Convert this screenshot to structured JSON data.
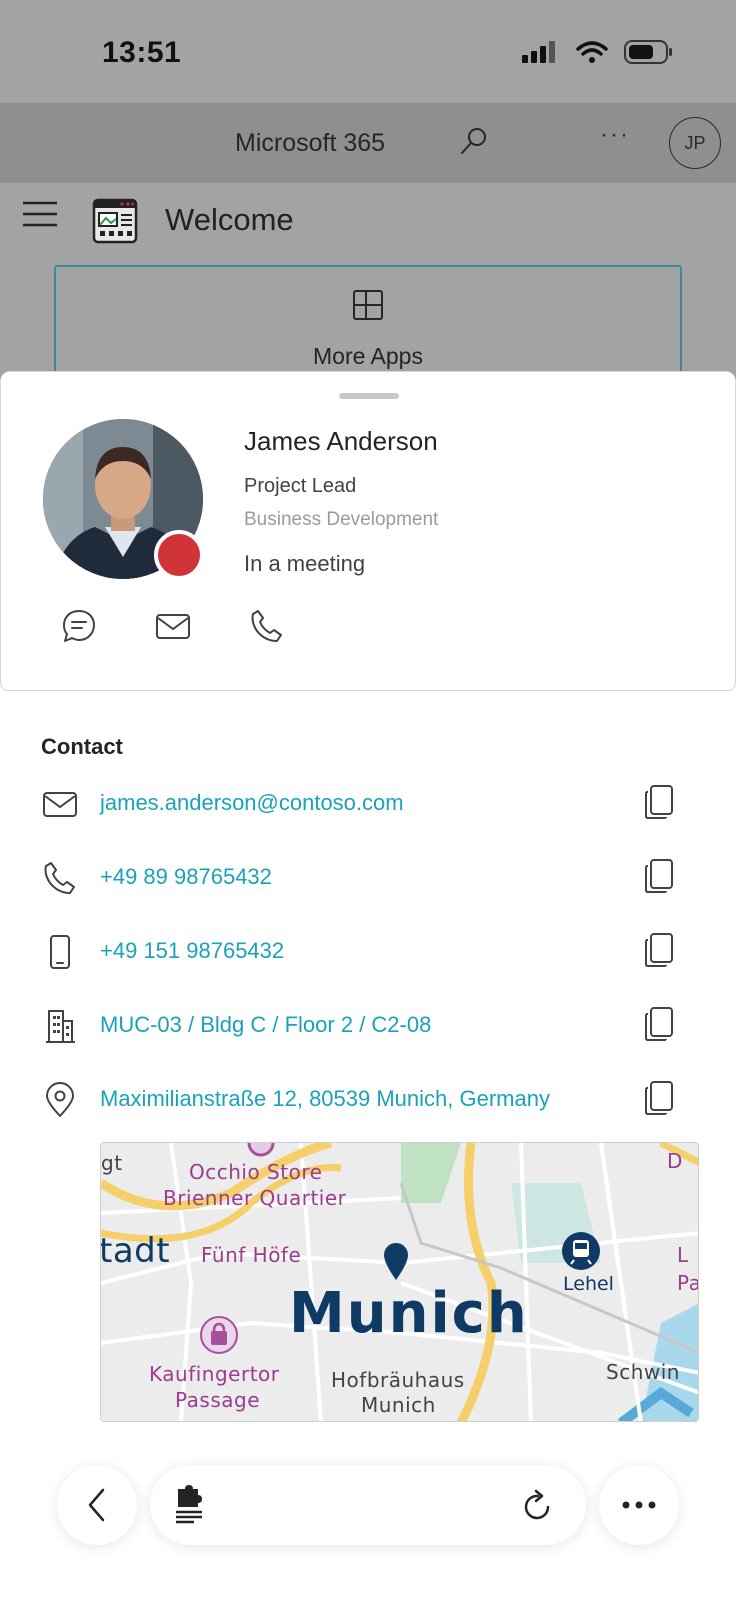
{
  "status_bar": {
    "time": "13:51"
  },
  "app_header": {
    "title": "Microsoft 365",
    "more_label": "···",
    "avatar_initials": "JP"
  },
  "page": {
    "title": "Welcome",
    "more_apps_label": "More Apps"
  },
  "profile": {
    "name": "James Anderson",
    "role": "Project Lead",
    "department": "Business Development",
    "status": "In a meeting",
    "presence_color": "#d13438"
  },
  "contact": {
    "heading": "Contact",
    "email": "james.anderson@contoso.com",
    "work_phone": "+49 89 98765432",
    "mobile_phone": "+49 151 98765432",
    "office": "MUC-03 / Bldg C / Floor 2 / C2-08",
    "address": "Maximilianstraße 12, 80539 Munich, Germany"
  },
  "map": {
    "city": "Munich",
    "labels": {
      "occhio": "Occhio Store",
      "brienner": "Brienner Quartier",
      "fuenf_hoefe": "Fünf Höfe",
      "stadt_fragment": "tadt",
      "gt_fragment": "gt",
      "kaufingertor_1": "Kaufingertor",
      "kaufingertor_2": "Passage",
      "hofbraeuhaus_1": "Hofbräuhaus",
      "hofbraeuhaus_2": "Munich",
      "lehel": "Lehel",
      "schwin": "Schwin",
      "d_fragment": "D",
      "l_fragment": "L",
      "pa_fragment": "Pa"
    }
  },
  "colors": {
    "link": "#1aa3b8",
    "accent_border": "#3b8a95",
    "map_city": "#0f3a63",
    "poi": "#9b3d8d"
  }
}
